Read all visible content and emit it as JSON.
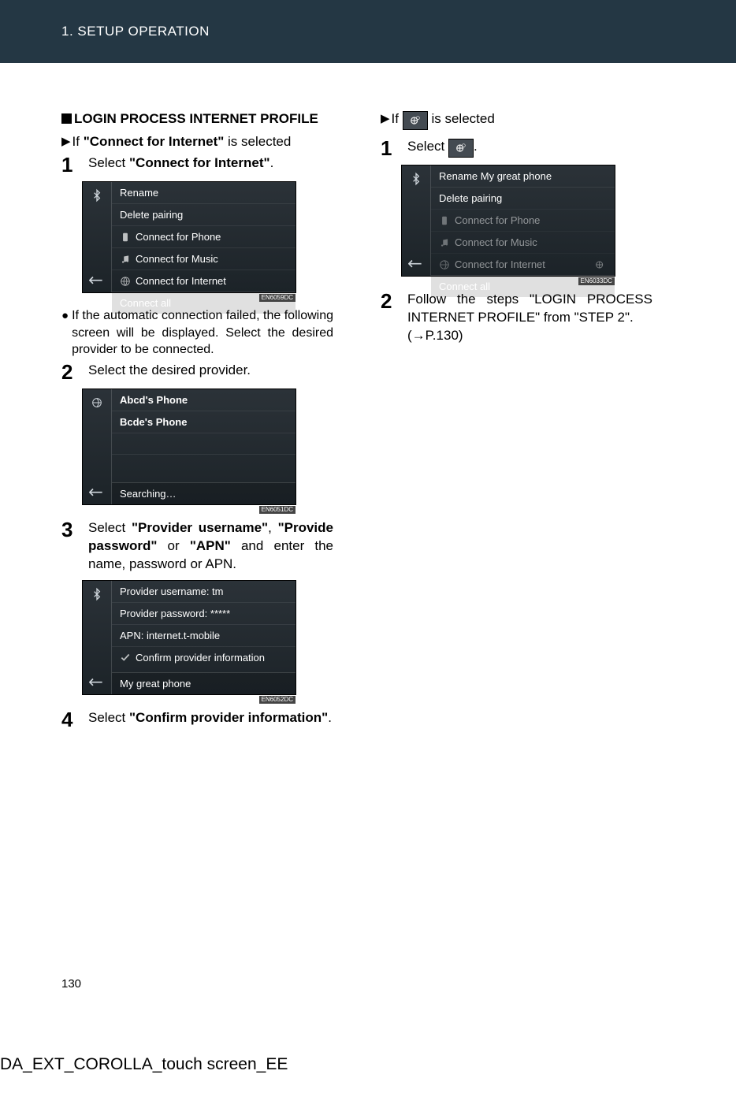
{
  "header": {
    "section_label": "1. SETUP OPERATION"
  },
  "left_col": {
    "login_title": "LOGIN PROCESS INTERNET PROFILE",
    "cond_if": "If ",
    "cond_text_strong": "\"Connect for Internet\"",
    "cond_suffix": " is selected",
    "step1_pre": "Select ",
    "step1_strong": "\"Connect for Internet\"",
    "step1_post": ".",
    "screenshot1": {
      "rename": "Rename",
      "delete": "Delete pairing",
      "phone": "Connect for Phone",
      "music": "Connect for Music",
      "internet": "Connect for Internet",
      "all": "Connect all",
      "tag": "EN6059DC"
    },
    "bullet_text": "If the automatic connection failed, the following screen will be displayed. Select the desired provider to be connected.",
    "step2": "Select the desired provider.",
    "screenshot2": {
      "item1": "Abcd's Phone",
      "item2": "Bcde's Phone",
      "footer": "Searching…",
      "tag": "EN6051DC"
    },
    "step3_pre": "Select ",
    "step3_s1": "\"Provider username\"",
    "step3_mid1": ", ",
    "step3_s2": "\"Provide password\"",
    "step3_mid2": " or ",
    "step3_s3": "\"APN\"",
    "step3_post": " and enter the name, password or APN.",
    "screenshot3": {
      "user": "Provider username: tm",
      "pass": "Provider password: *****",
      "apn": "APN: internet.t-mobile",
      "confirm": "Confirm provider information",
      "footer": "My great phone",
      "tag": "EN6052DC"
    },
    "step4_pre": "Select ",
    "step4_strong": "\"Confirm provider information\"",
    "step4_post": "."
  },
  "right_col": {
    "cond_if": "If",
    "cond_end": "is selected",
    "step1": "Select",
    "step1_post": ".",
    "screenshot1": {
      "rename": "Rename My great phone",
      "delete": "Delete pairing",
      "phone": "Connect for Phone",
      "music": "Connect for Music",
      "internet": "Connect for Internet",
      "all": "Connect all",
      "tag": "EN6033DC"
    },
    "step2a": "Follow the steps \"LOGIN PROCESS INTERNET PROFILE\" from \"STEP 2\".",
    "step2b": "(→P.130)"
  },
  "page_number": "130",
  "doc_id": "DA_EXT_COROLLA_touch screen_EE"
}
